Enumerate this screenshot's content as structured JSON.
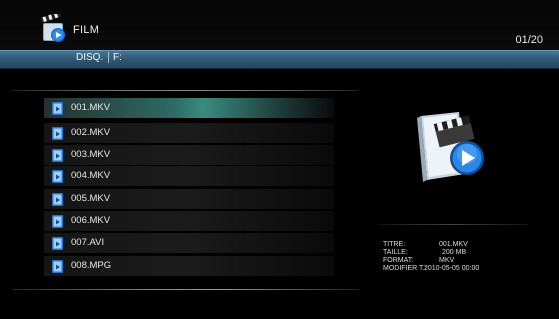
{
  "header": {
    "title": "FILM",
    "page_counter": "01/20",
    "app_icon": "film-clapper-play-icon"
  },
  "path": {
    "disk_label": "DISQ.",
    "drive_label": "F:"
  },
  "colors": {
    "pathbar": "#2d5672",
    "selection": "#3a8b80",
    "background": "#000000"
  },
  "files": [
    {
      "name": "001.MKV",
      "icon": "video-file-icon",
      "selected": true
    },
    {
      "name": "002.MKV",
      "icon": "video-file-icon",
      "selected": false
    },
    {
      "name": "003.MKV",
      "icon": "video-file-icon",
      "selected": false
    },
    {
      "name": "004.MKV",
      "icon": "video-file-icon",
      "selected": false
    },
    {
      "name": "005.MKV",
      "icon": "video-file-icon",
      "selected": false
    },
    {
      "name": "006.MKV",
      "icon": "video-file-icon",
      "selected": false
    },
    {
      "name": "007.AVI",
      "icon": "video-file-icon",
      "selected": false
    },
    {
      "name": "008.MPG",
      "icon": "video-file-icon",
      "selected": false
    }
  ],
  "details": {
    "preview_icon": "video-document-preview-icon",
    "titre_label": "TITRE:",
    "titre_value": "001.MKV",
    "taille_label": "TAILLE:",
    "taille_value": "200 MB",
    "format_label": "FORMAT:",
    "format_value": "MKV",
    "modifier_label": "MODIFIER T.:",
    "modifier_value": "2010-05-05  00:00"
  }
}
